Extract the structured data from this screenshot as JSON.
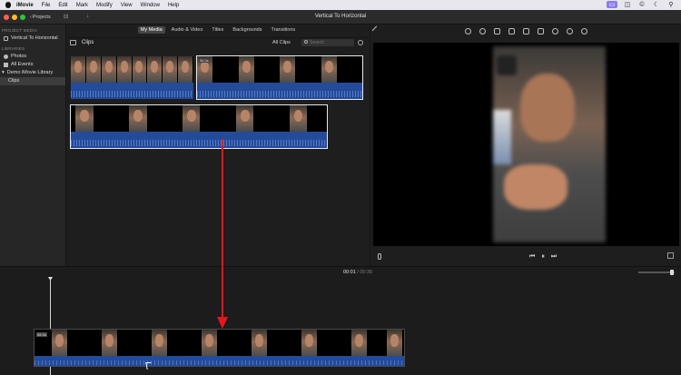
{
  "menubar": {
    "app_name": "iMovie",
    "items": [
      "File",
      "Edit",
      "Mark",
      "Modify",
      "View",
      "Window",
      "Help"
    ]
  },
  "titlebar": {
    "projects_label": "Projects",
    "window_title": "Vertical To Horizontal"
  },
  "sidebar": {
    "project_media_header": "PROJECT MEDIA",
    "project_item": "Vertical To Horizontal",
    "libraries_header": "LIBRARIES",
    "library_items": [
      "Photos",
      "All Events",
      "Demo iMovie Library",
      "Clips"
    ]
  },
  "browser": {
    "tabs": [
      "My Media",
      "Audio & Video",
      "Titles",
      "Backgrounds",
      "Transitions"
    ],
    "active_tab": "My Media",
    "section_title": "Clips",
    "filter_label": "All Clips",
    "search_placeholder": "Search",
    "clip_duration_label": "58.3s"
  },
  "timeline": {
    "current_time": "00:01",
    "separator": "/",
    "total_time": "00:36",
    "clip_label": "58.3s"
  },
  "colors": {
    "annotation_arrow": "#e8151b",
    "audio_waveform": "#244b9a",
    "menubar_highlight": "#8a7cf0"
  }
}
